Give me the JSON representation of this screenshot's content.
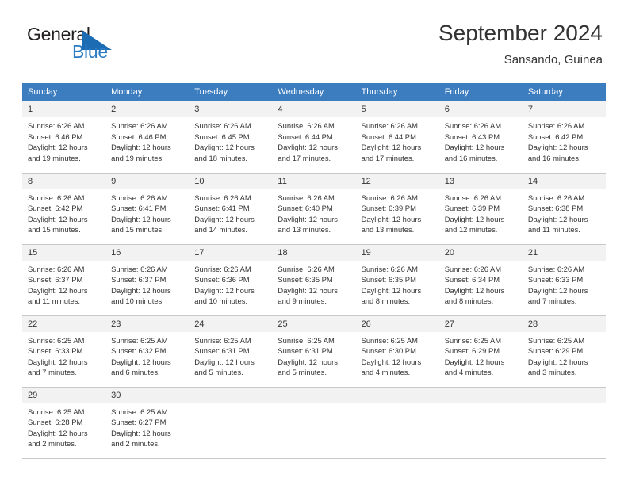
{
  "brand": {
    "name_part1": "General",
    "name_part2": "Blue",
    "mark": "triangle-logo-icon",
    "accent_color": "#2b7cc4",
    "text_color": "#231f20"
  },
  "header": {
    "title": "September 2024",
    "subtitle": "Sansando, Guinea"
  },
  "calendar": {
    "header_bg": "#3c7dc0",
    "daynum_bg": "#f2f2f2",
    "border_color": "#c8c8c8",
    "weekdays": [
      "Sunday",
      "Monday",
      "Tuesday",
      "Wednesday",
      "Thursday",
      "Friday",
      "Saturday"
    ],
    "weeks": [
      [
        {
          "day": "1",
          "sunrise": "Sunrise: 6:26 AM",
          "sunset": "Sunset: 6:46 PM",
          "daylight_line1": "Daylight: 12 hours",
          "daylight_line2": "and 19 minutes."
        },
        {
          "day": "2",
          "sunrise": "Sunrise: 6:26 AM",
          "sunset": "Sunset: 6:46 PM",
          "daylight_line1": "Daylight: 12 hours",
          "daylight_line2": "and 19 minutes."
        },
        {
          "day": "3",
          "sunrise": "Sunrise: 6:26 AM",
          "sunset": "Sunset: 6:45 PM",
          "daylight_line1": "Daylight: 12 hours",
          "daylight_line2": "and 18 minutes."
        },
        {
          "day": "4",
          "sunrise": "Sunrise: 6:26 AM",
          "sunset": "Sunset: 6:44 PM",
          "daylight_line1": "Daylight: 12 hours",
          "daylight_line2": "and 17 minutes."
        },
        {
          "day": "5",
          "sunrise": "Sunrise: 6:26 AM",
          "sunset": "Sunset: 6:44 PM",
          "daylight_line1": "Daylight: 12 hours",
          "daylight_line2": "and 17 minutes."
        },
        {
          "day": "6",
          "sunrise": "Sunrise: 6:26 AM",
          "sunset": "Sunset: 6:43 PM",
          "daylight_line1": "Daylight: 12 hours",
          "daylight_line2": "and 16 minutes."
        },
        {
          "day": "7",
          "sunrise": "Sunrise: 6:26 AM",
          "sunset": "Sunset: 6:42 PM",
          "daylight_line1": "Daylight: 12 hours",
          "daylight_line2": "and 16 minutes."
        }
      ],
      [
        {
          "day": "8",
          "sunrise": "Sunrise: 6:26 AM",
          "sunset": "Sunset: 6:42 PM",
          "daylight_line1": "Daylight: 12 hours",
          "daylight_line2": "and 15 minutes."
        },
        {
          "day": "9",
          "sunrise": "Sunrise: 6:26 AM",
          "sunset": "Sunset: 6:41 PM",
          "daylight_line1": "Daylight: 12 hours",
          "daylight_line2": "and 15 minutes."
        },
        {
          "day": "10",
          "sunrise": "Sunrise: 6:26 AM",
          "sunset": "Sunset: 6:41 PM",
          "daylight_line1": "Daylight: 12 hours",
          "daylight_line2": "and 14 minutes."
        },
        {
          "day": "11",
          "sunrise": "Sunrise: 6:26 AM",
          "sunset": "Sunset: 6:40 PM",
          "daylight_line1": "Daylight: 12 hours",
          "daylight_line2": "and 13 minutes."
        },
        {
          "day": "12",
          "sunrise": "Sunrise: 6:26 AM",
          "sunset": "Sunset: 6:39 PM",
          "daylight_line1": "Daylight: 12 hours",
          "daylight_line2": "and 13 minutes."
        },
        {
          "day": "13",
          "sunrise": "Sunrise: 6:26 AM",
          "sunset": "Sunset: 6:39 PM",
          "daylight_line1": "Daylight: 12 hours",
          "daylight_line2": "and 12 minutes."
        },
        {
          "day": "14",
          "sunrise": "Sunrise: 6:26 AM",
          "sunset": "Sunset: 6:38 PM",
          "daylight_line1": "Daylight: 12 hours",
          "daylight_line2": "and 11 minutes."
        }
      ],
      [
        {
          "day": "15",
          "sunrise": "Sunrise: 6:26 AM",
          "sunset": "Sunset: 6:37 PM",
          "daylight_line1": "Daylight: 12 hours",
          "daylight_line2": "and 11 minutes."
        },
        {
          "day": "16",
          "sunrise": "Sunrise: 6:26 AM",
          "sunset": "Sunset: 6:37 PM",
          "daylight_line1": "Daylight: 12 hours",
          "daylight_line2": "and 10 minutes."
        },
        {
          "day": "17",
          "sunrise": "Sunrise: 6:26 AM",
          "sunset": "Sunset: 6:36 PM",
          "daylight_line1": "Daylight: 12 hours",
          "daylight_line2": "and 10 minutes."
        },
        {
          "day": "18",
          "sunrise": "Sunrise: 6:26 AM",
          "sunset": "Sunset: 6:35 PM",
          "daylight_line1": "Daylight: 12 hours",
          "daylight_line2": "and 9 minutes."
        },
        {
          "day": "19",
          "sunrise": "Sunrise: 6:26 AM",
          "sunset": "Sunset: 6:35 PM",
          "daylight_line1": "Daylight: 12 hours",
          "daylight_line2": "and 8 minutes."
        },
        {
          "day": "20",
          "sunrise": "Sunrise: 6:26 AM",
          "sunset": "Sunset: 6:34 PM",
          "daylight_line1": "Daylight: 12 hours",
          "daylight_line2": "and 8 minutes."
        },
        {
          "day": "21",
          "sunrise": "Sunrise: 6:26 AM",
          "sunset": "Sunset: 6:33 PM",
          "daylight_line1": "Daylight: 12 hours",
          "daylight_line2": "and 7 minutes."
        }
      ],
      [
        {
          "day": "22",
          "sunrise": "Sunrise: 6:25 AM",
          "sunset": "Sunset: 6:33 PM",
          "daylight_line1": "Daylight: 12 hours",
          "daylight_line2": "and 7 minutes."
        },
        {
          "day": "23",
          "sunrise": "Sunrise: 6:25 AM",
          "sunset": "Sunset: 6:32 PM",
          "daylight_line1": "Daylight: 12 hours",
          "daylight_line2": "and 6 minutes."
        },
        {
          "day": "24",
          "sunrise": "Sunrise: 6:25 AM",
          "sunset": "Sunset: 6:31 PM",
          "daylight_line1": "Daylight: 12 hours",
          "daylight_line2": "and 5 minutes."
        },
        {
          "day": "25",
          "sunrise": "Sunrise: 6:25 AM",
          "sunset": "Sunset: 6:31 PM",
          "daylight_line1": "Daylight: 12 hours",
          "daylight_line2": "and 5 minutes."
        },
        {
          "day": "26",
          "sunrise": "Sunrise: 6:25 AM",
          "sunset": "Sunset: 6:30 PM",
          "daylight_line1": "Daylight: 12 hours",
          "daylight_line2": "and 4 minutes."
        },
        {
          "day": "27",
          "sunrise": "Sunrise: 6:25 AM",
          "sunset": "Sunset: 6:29 PM",
          "daylight_line1": "Daylight: 12 hours",
          "daylight_line2": "and 4 minutes."
        },
        {
          "day": "28",
          "sunrise": "Sunrise: 6:25 AM",
          "sunset": "Sunset: 6:29 PM",
          "daylight_line1": "Daylight: 12 hours",
          "daylight_line2": "and 3 minutes."
        }
      ],
      [
        {
          "day": "29",
          "sunrise": "Sunrise: 6:25 AM",
          "sunset": "Sunset: 6:28 PM",
          "daylight_line1": "Daylight: 12 hours",
          "daylight_line2": "and 2 minutes."
        },
        {
          "day": "30",
          "sunrise": "Sunrise: 6:25 AM",
          "sunset": "Sunset: 6:27 PM",
          "daylight_line1": "Daylight: 12 hours",
          "daylight_line2": "and 2 minutes."
        },
        {
          "day": "",
          "sunrise": "",
          "sunset": "",
          "daylight_line1": "",
          "daylight_line2": ""
        },
        {
          "day": "",
          "sunrise": "",
          "sunset": "",
          "daylight_line1": "",
          "daylight_line2": ""
        },
        {
          "day": "",
          "sunrise": "",
          "sunset": "",
          "daylight_line1": "",
          "daylight_line2": ""
        },
        {
          "day": "",
          "sunrise": "",
          "sunset": "",
          "daylight_line1": "",
          "daylight_line2": ""
        },
        {
          "day": "",
          "sunrise": "",
          "sunset": "",
          "daylight_line1": "",
          "daylight_line2": ""
        }
      ]
    ]
  }
}
